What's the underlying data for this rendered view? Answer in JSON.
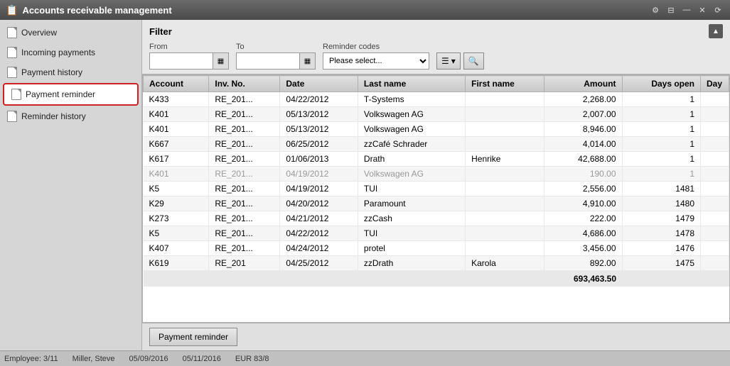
{
  "window": {
    "title": "Accounts receivable management"
  },
  "titlebar": {
    "controls": [
      "⚙",
      "⊞",
      "—",
      "✕",
      "⟳"
    ]
  },
  "sidebar": {
    "items": [
      {
        "id": "overview",
        "label": "Overview",
        "active": false
      },
      {
        "id": "incoming-payments",
        "label": "Incoming payments",
        "active": false
      },
      {
        "id": "payment-history",
        "label": "Payment history",
        "active": false
      },
      {
        "id": "payment-reminder",
        "label": "Payment reminder",
        "active": true
      },
      {
        "id": "reminder-history",
        "label": "Reminder history",
        "active": false
      }
    ]
  },
  "filter": {
    "title": "Filter",
    "from_label": "From",
    "to_label": "To",
    "reminder_codes_label": "Reminder codes",
    "from_value": "",
    "to_value": "",
    "reminder_placeholder": "Please select...",
    "btn_filter_icon": "☰",
    "btn_search_icon": "🔍"
  },
  "table": {
    "columns": [
      "Account",
      "Inv. No.",
      "Date",
      "Last name",
      "First name",
      "Amount",
      "Days open",
      "Day"
    ],
    "rows": [
      {
        "account": "K433",
        "inv_no": "RE_201...",
        "date": "04/22/2012",
        "last_name": "T-Systems",
        "first_name": "",
        "amount": "2,268.00",
        "days_open": "1",
        "day": "",
        "grey": false
      },
      {
        "account": "K401",
        "inv_no": "RE_201...",
        "date": "05/13/2012",
        "last_name": "Volkswagen AG",
        "first_name": "",
        "amount": "2,007.00",
        "days_open": "1",
        "day": "",
        "grey": false
      },
      {
        "account": "K401",
        "inv_no": "RE_201...",
        "date": "05/13/2012",
        "last_name": "Volkswagen AG",
        "first_name": "",
        "amount": "8,946.00",
        "days_open": "1",
        "day": "",
        "grey": false
      },
      {
        "account": "K667",
        "inv_no": "RE_201...",
        "date": "06/25/2012",
        "last_name": "zzCafé Schrader",
        "first_name": "",
        "amount": "4,014.00",
        "days_open": "1",
        "day": "",
        "grey": false
      },
      {
        "account": "K617",
        "inv_no": "RE_201...",
        "date": "01/06/2013",
        "last_name": "Drath",
        "first_name": "Henrike",
        "amount": "42,688.00",
        "days_open": "1",
        "day": "",
        "grey": false
      },
      {
        "account": "K401",
        "inv_no": "RE_201...",
        "date": "04/19/2012",
        "last_name": "Volkswagen AG",
        "first_name": "",
        "amount": "190.00",
        "days_open": "1",
        "day": "",
        "grey": true
      },
      {
        "account": "K5",
        "inv_no": "RE_201...",
        "date": "04/19/2012",
        "last_name": "TUI",
        "first_name": "",
        "amount": "2,556.00",
        "days_open": "1481",
        "day": "",
        "grey": false
      },
      {
        "account": "K29",
        "inv_no": "RE_201...",
        "date": "04/20/2012",
        "last_name": "Paramount",
        "first_name": "",
        "amount": "4,910.00",
        "days_open": "1480",
        "day": "",
        "grey": false
      },
      {
        "account": "K273",
        "inv_no": "RE_201...",
        "date": "04/21/2012",
        "last_name": "zzCash",
        "first_name": "",
        "amount": "222.00",
        "days_open": "1479",
        "day": "",
        "grey": false
      },
      {
        "account": "K5",
        "inv_no": "RE_201...",
        "date": "04/22/2012",
        "last_name": "TUI",
        "first_name": "",
        "amount": "4,686.00",
        "days_open": "1478",
        "day": "",
        "grey": false
      },
      {
        "account": "K407",
        "inv_no": "RE_201...",
        "date": "04/24/2012",
        "last_name": "protel",
        "first_name": "",
        "amount": "3,456.00",
        "days_open": "1476",
        "day": "",
        "grey": false
      },
      {
        "account": "K619",
        "inv_no": "RE_201",
        "date": "04/25/2012",
        "last_name": "zzDrath",
        "first_name": "Karola",
        "amount": "892.00",
        "days_open": "1475",
        "day": "",
        "grey": false
      }
    ],
    "total_amount": "693,463.50"
  },
  "footer": {
    "payment_reminder_btn": "Payment reminder"
  },
  "status_bar": {
    "items": [
      "Employee: 3/11",
      "Miller, Steve",
      "05/09/2016",
      "05/11/2016",
      "EUR 83/8"
    ]
  }
}
